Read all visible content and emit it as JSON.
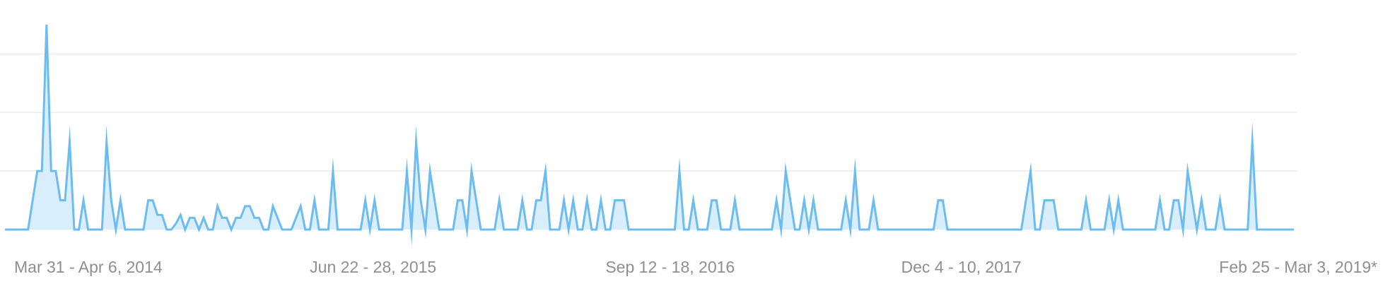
{
  "colors": {
    "line": "#6cbcf0",
    "area": "#d9eefc",
    "grid": "#ebebeb",
    "tick_text": "#8e8e93",
    "background": "#ffffff"
  },
  "chart_data": {
    "type": "area",
    "title": "",
    "xlabel": "",
    "ylabel": "",
    "ylim": [
      0,
      7
    ],
    "yticks": [
      0,
      2,
      4,
      6
    ],
    "grid": true,
    "legend": "none",
    "y_axis_labels_visible": false,
    "x_tick_labels": [
      {
        "label": "Mar 31 - Apr 6, 2014",
        "index": 0
      },
      {
        "label": "Jun 22 - 28, 2015",
        "index": 64
      },
      {
        "label": "Sep 12 - 18, 2016",
        "index": 128
      },
      {
        "label": "Dec 4 - 10, 2017",
        "index": 192
      },
      {
        "label": "Feb 25 - Mar 3, 2019*",
        "index": 256
      }
    ],
    "series": [
      {
        "values": [
          0,
          0,
          0,
          0,
          0,
          0,
          1,
          2,
          2,
          7,
          2,
          2,
          1,
          1,
          3,
          0,
          0,
          1,
          0,
          0,
          0,
          0,
          3,
          1,
          0,
          1,
          0,
          0,
          0,
          0,
          0,
          1,
          1,
          0.5,
          0.5,
          0,
          0,
          0.2,
          0.5,
          0,
          0.4,
          0.4,
          0,
          0.4,
          0,
          0,
          0.8,
          0.4,
          0.4,
          0,
          0.4,
          0.4,
          0.8,
          0.8,
          0.4,
          0.4,
          0,
          0,
          0.8,
          0.4,
          0,
          0,
          0,
          0.4,
          0.8,
          0,
          0,
          1,
          0,
          0,
          0,
          2,
          0,
          0,
          0,
          0,
          0,
          0,
          1,
          0,
          1,
          0,
          0,
          0,
          0,
          0,
          0,
          2,
          0,
          3,
          1,
          0,
          2,
          1,
          0,
          0,
          0,
          0,
          1,
          1,
          0,
          2,
          1,
          0,
          0,
          0,
          0,
          1,
          0,
          0,
          0,
          0,
          1,
          0,
          0,
          1,
          1,
          2,
          0,
          0,
          0,
          1,
          0,
          1,
          0,
          0,
          1,
          0,
          0,
          1,
          0,
          0,
          1,
          1,
          1,
          0,
          0,
          0,
          0,
          0,
          0,
          0,
          0,
          0,
          0,
          0,
          2,
          0,
          0,
          1,
          0,
          0,
          0,
          1,
          1,
          0,
          0,
          0,
          1,
          0,
          0,
          0,
          0,
          0,
          0,
          0,
          0,
          1,
          0,
          2,
          1,
          0,
          0,
          1,
          0,
          1,
          0,
          0,
          0,
          0,
          0,
          0,
          1,
          0,
          2,
          0,
          0,
          0,
          1,
          0,
          0,
          0,
          0,
          0,
          0,
          0,
          0,
          0,
          0,
          0,
          0,
          0,
          1,
          1,
          0,
          0,
          0,
          0,
          0,
          0,
          0,
          0,
          0,
          0,
          0,
          0,
          0,
          0,
          0,
          0,
          0,
          1,
          2,
          0,
          0,
          1,
          1,
          1,
          0,
          0,
          0,
          0,
          0,
          0,
          1,
          0,
          0,
          0,
          0,
          1,
          0,
          1,
          0,
          0,
          0,
          0,
          0,
          0,
          0,
          0,
          1,
          0,
          0,
          1,
          1,
          0,
          2,
          1,
          0,
          1,
          0,
          0,
          0,
          1,
          0,
          0,
          0,
          0,
          0,
          0,
          3,
          0,
          0,
          0,
          0,
          0,
          0,
          0,
          0,
          0
        ]
      }
    ]
  }
}
